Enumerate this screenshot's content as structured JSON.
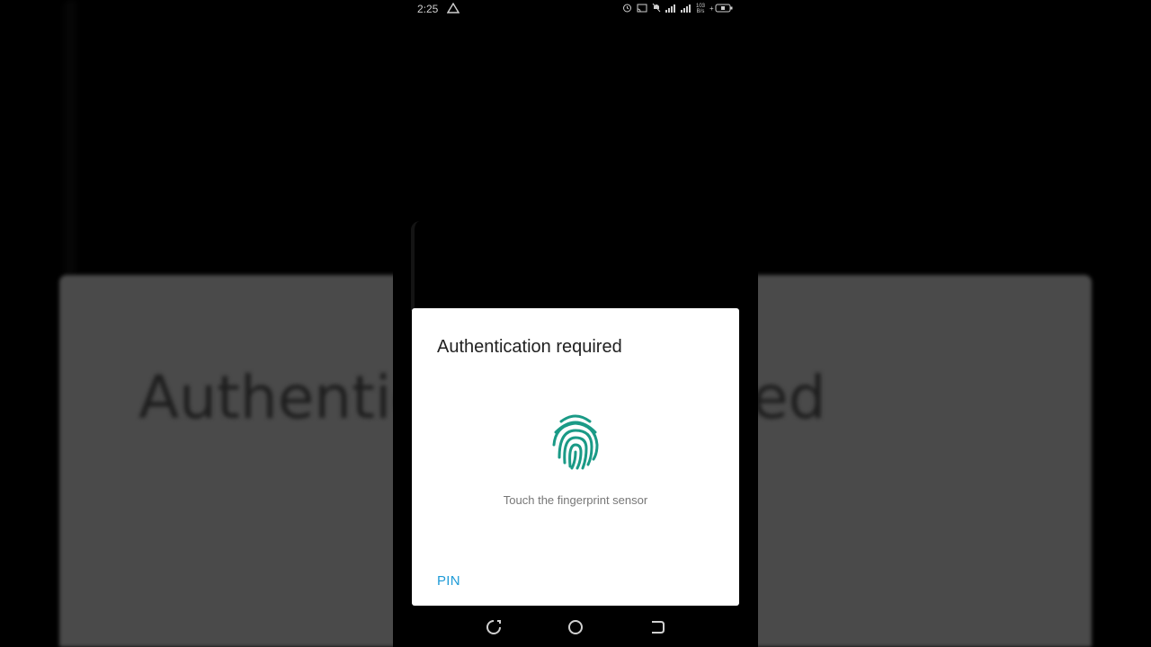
{
  "background": {
    "text_left": "Authentic",
    "text_right": "ed"
  },
  "status_bar": {
    "time": "2:25",
    "speed_value": "103",
    "speed_unit": "B/s"
  },
  "dialog": {
    "title": "Authentication required",
    "hint": "Touch the fingerprint sensor",
    "pin_label": "PIN",
    "accent_color": "#1e9bd7",
    "icon_color": "#1a9a86"
  },
  "icons": [
    "warning-icon",
    "alarm-icon",
    "cast-icon",
    "mute-icon",
    "signal-icon",
    "battery-icon",
    "fingerprint-icon",
    "recents-icon",
    "home-icon",
    "back-icon"
  ]
}
